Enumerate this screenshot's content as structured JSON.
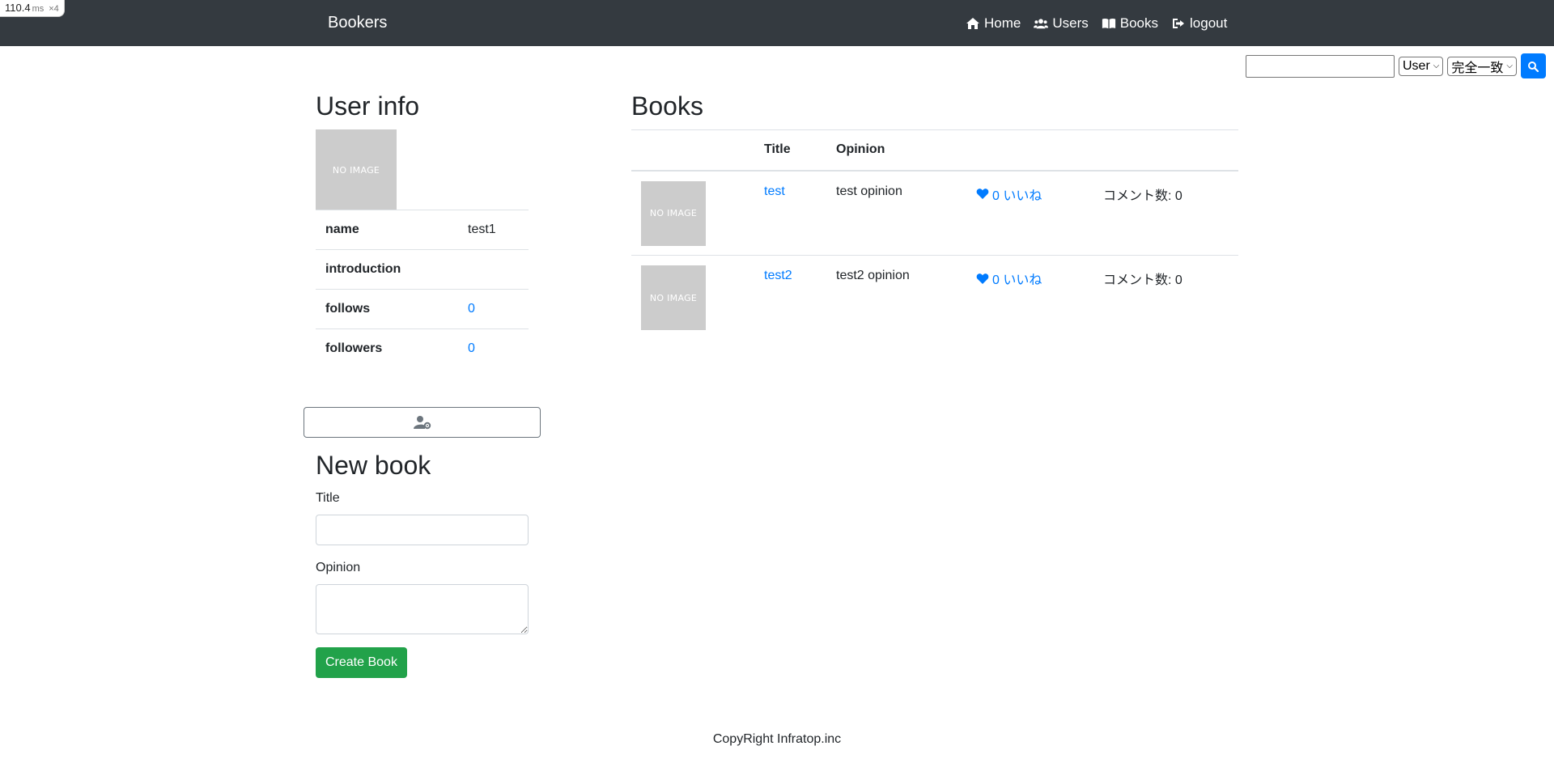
{
  "perf": {
    "value": "110.4",
    "unit": "ms",
    "mult": "×4"
  },
  "navbar": {
    "brand": "Bookers",
    "items": [
      {
        "label": "Home",
        "icon": "home-icon"
      },
      {
        "label": "Users",
        "icon": "users-icon"
      },
      {
        "label": "Books",
        "icon": "book-open-icon"
      },
      {
        "label": "logout",
        "icon": "sign-out-icon"
      }
    ]
  },
  "search": {
    "query": "",
    "target": "User",
    "match": "完全一致",
    "button_icon": "search-icon"
  },
  "user_info": {
    "title": "User info",
    "image_text": "NO IMAGE",
    "rows": [
      {
        "key": "name",
        "value": "test1"
      },
      {
        "key": "introduction",
        "value": ""
      },
      {
        "key": "follows",
        "value": "0"
      },
      {
        "key": "followers",
        "value": "0"
      }
    ],
    "edit_icon": "user-cog-icon"
  },
  "new_book": {
    "title": "New book",
    "title_label": "Title",
    "opinion_label": "Opinion",
    "submit_label": "Create Book"
  },
  "books": {
    "title": "Books",
    "headers": [
      "",
      "Title",
      "Opinion",
      "",
      ""
    ],
    "rows": [
      {
        "image_text": "NO IMAGE",
        "title": "test",
        "opinion": "test opinion",
        "likes": "0 いいね",
        "comments": "コメント数: 0"
      },
      {
        "image_text": "NO IMAGE",
        "title": "test2",
        "opinion": "test2 opinion",
        "likes": "0 いいね",
        "comments": "コメント数: 0"
      }
    ]
  },
  "footer": {
    "text": "CopyRight Infratop.inc"
  },
  "colors": {
    "navbar": "#343a40",
    "primary": "#007bff",
    "success": "#22a24a",
    "placeholder": "#cccccc"
  }
}
